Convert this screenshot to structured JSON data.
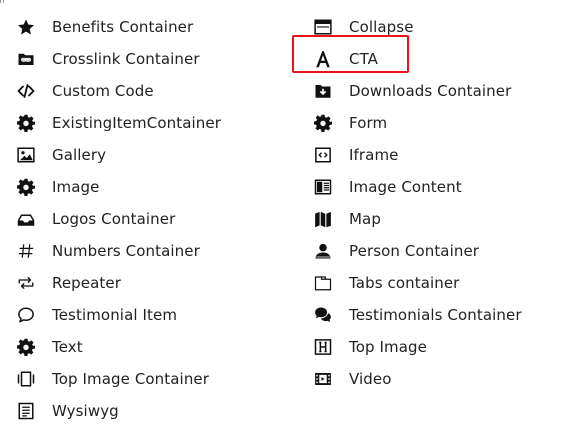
{
  "left_column": [
    {
      "label": "Benefits Container",
      "icon": "star-icon"
    },
    {
      "label": "Crosslink Container",
      "icon": "folder-link-icon"
    },
    {
      "label": "Custom Code",
      "icon": "code-icon"
    },
    {
      "label": "ExistingItemContainer",
      "icon": "gear-icon"
    },
    {
      "label": "Gallery",
      "icon": "picture-icon"
    },
    {
      "label": "Image",
      "icon": "gear-icon"
    },
    {
      "label": "Logos Container",
      "icon": "inbox-icon"
    },
    {
      "label": "Numbers Container",
      "icon": "hash-icon"
    },
    {
      "label": "Repeater",
      "icon": "repeat-icon"
    },
    {
      "label": "Testimonial Item",
      "icon": "speech-bubble-icon"
    },
    {
      "label": "Text",
      "icon": "gear-icon"
    },
    {
      "label": "Top Image Container",
      "icon": "carousel-icon"
    },
    {
      "label": "Wysiwyg",
      "icon": "list-box-icon"
    }
  ],
  "right_column": [
    {
      "label": "Collapse",
      "icon": "window-icon"
    },
    {
      "label": "CTA",
      "icon": "letter-a-icon"
    },
    {
      "label": "Downloads Container",
      "icon": "download-box-icon"
    },
    {
      "label": "Form",
      "icon": "gear-icon"
    },
    {
      "label": "Iframe",
      "icon": "code-box-icon"
    },
    {
      "label": "Image Content",
      "icon": "newspaper-icon"
    },
    {
      "label": "Map",
      "icon": "map-icon"
    },
    {
      "label": "Person Container",
      "icon": "person-icon"
    },
    {
      "label": "Tabs container",
      "icon": "tabs-icon"
    },
    {
      "label": "Testimonials Container",
      "icon": "comments-icon"
    },
    {
      "label": "Top Image",
      "icon": "header-h-icon"
    },
    {
      "label": "Video",
      "icon": "film-icon"
    }
  ],
  "highlight": {
    "item": "CTA",
    "color": "#e8141c"
  }
}
